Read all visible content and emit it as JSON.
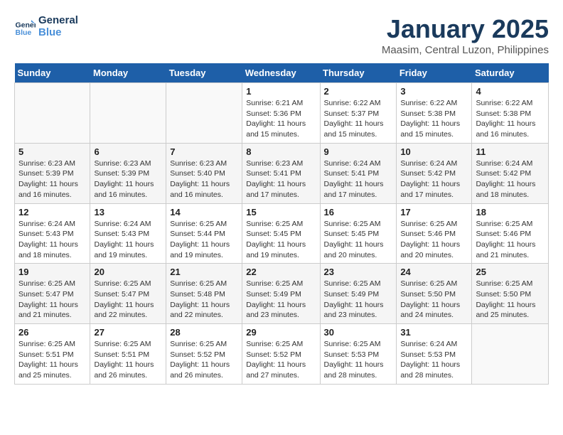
{
  "header": {
    "logo_line1": "General",
    "logo_line2": "Blue",
    "month": "January 2025",
    "location": "Maasim, Central Luzon, Philippines"
  },
  "weekdays": [
    "Sunday",
    "Monday",
    "Tuesday",
    "Wednesday",
    "Thursday",
    "Friday",
    "Saturday"
  ],
  "weeks": [
    [
      {
        "day": "",
        "info": ""
      },
      {
        "day": "",
        "info": ""
      },
      {
        "day": "",
        "info": ""
      },
      {
        "day": "1",
        "info": "Sunrise: 6:21 AM\nSunset: 5:36 PM\nDaylight: 11 hours\nand 15 minutes."
      },
      {
        "day": "2",
        "info": "Sunrise: 6:22 AM\nSunset: 5:37 PM\nDaylight: 11 hours\nand 15 minutes."
      },
      {
        "day": "3",
        "info": "Sunrise: 6:22 AM\nSunset: 5:38 PM\nDaylight: 11 hours\nand 15 minutes."
      },
      {
        "day": "4",
        "info": "Sunrise: 6:22 AM\nSunset: 5:38 PM\nDaylight: 11 hours\nand 16 minutes."
      }
    ],
    [
      {
        "day": "5",
        "info": "Sunrise: 6:23 AM\nSunset: 5:39 PM\nDaylight: 11 hours\nand 16 minutes."
      },
      {
        "day": "6",
        "info": "Sunrise: 6:23 AM\nSunset: 5:39 PM\nDaylight: 11 hours\nand 16 minutes."
      },
      {
        "day": "7",
        "info": "Sunrise: 6:23 AM\nSunset: 5:40 PM\nDaylight: 11 hours\nand 16 minutes."
      },
      {
        "day": "8",
        "info": "Sunrise: 6:23 AM\nSunset: 5:41 PM\nDaylight: 11 hours\nand 17 minutes."
      },
      {
        "day": "9",
        "info": "Sunrise: 6:24 AM\nSunset: 5:41 PM\nDaylight: 11 hours\nand 17 minutes."
      },
      {
        "day": "10",
        "info": "Sunrise: 6:24 AM\nSunset: 5:42 PM\nDaylight: 11 hours\nand 17 minutes."
      },
      {
        "day": "11",
        "info": "Sunrise: 6:24 AM\nSunset: 5:42 PM\nDaylight: 11 hours\nand 18 minutes."
      }
    ],
    [
      {
        "day": "12",
        "info": "Sunrise: 6:24 AM\nSunset: 5:43 PM\nDaylight: 11 hours\nand 18 minutes."
      },
      {
        "day": "13",
        "info": "Sunrise: 6:24 AM\nSunset: 5:43 PM\nDaylight: 11 hours\nand 19 minutes."
      },
      {
        "day": "14",
        "info": "Sunrise: 6:25 AM\nSunset: 5:44 PM\nDaylight: 11 hours\nand 19 minutes."
      },
      {
        "day": "15",
        "info": "Sunrise: 6:25 AM\nSunset: 5:45 PM\nDaylight: 11 hours\nand 19 minutes."
      },
      {
        "day": "16",
        "info": "Sunrise: 6:25 AM\nSunset: 5:45 PM\nDaylight: 11 hours\nand 20 minutes."
      },
      {
        "day": "17",
        "info": "Sunrise: 6:25 AM\nSunset: 5:46 PM\nDaylight: 11 hours\nand 20 minutes."
      },
      {
        "day": "18",
        "info": "Sunrise: 6:25 AM\nSunset: 5:46 PM\nDaylight: 11 hours\nand 21 minutes."
      }
    ],
    [
      {
        "day": "19",
        "info": "Sunrise: 6:25 AM\nSunset: 5:47 PM\nDaylight: 11 hours\nand 21 minutes."
      },
      {
        "day": "20",
        "info": "Sunrise: 6:25 AM\nSunset: 5:47 PM\nDaylight: 11 hours\nand 22 minutes."
      },
      {
        "day": "21",
        "info": "Sunrise: 6:25 AM\nSunset: 5:48 PM\nDaylight: 11 hours\nand 22 minutes."
      },
      {
        "day": "22",
        "info": "Sunrise: 6:25 AM\nSunset: 5:49 PM\nDaylight: 11 hours\nand 23 minutes."
      },
      {
        "day": "23",
        "info": "Sunrise: 6:25 AM\nSunset: 5:49 PM\nDaylight: 11 hours\nand 23 minutes."
      },
      {
        "day": "24",
        "info": "Sunrise: 6:25 AM\nSunset: 5:50 PM\nDaylight: 11 hours\nand 24 minutes."
      },
      {
        "day": "25",
        "info": "Sunrise: 6:25 AM\nSunset: 5:50 PM\nDaylight: 11 hours\nand 25 minutes."
      }
    ],
    [
      {
        "day": "26",
        "info": "Sunrise: 6:25 AM\nSunset: 5:51 PM\nDaylight: 11 hours\nand 25 minutes."
      },
      {
        "day": "27",
        "info": "Sunrise: 6:25 AM\nSunset: 5:51 PM\nDaylight: 11 hours\nand 26 minutes."
      },
      {
        "day": "28",
        "info": "Sunrise: 6:25 AM\nSunset: 5:52 PM\nDaylight: 11 hours\nand 26 minutes."
      },
      {
        "day": "29",
        "info": "Sunrise: 6:25 AM\nSunset: 5:52 PM\nDaylight: 11 hours\nand 27 minutes."
      },
      {
        "day": "30",
        "info": "Sunrise: 6:25 AM\nSunset: 5:53 PM\nDaylight: 11 hours\nand 28 minutes."
      },
      {
        "day": "31",
        "info": "Sunrise: 6:24 AM\nSunset: 5:53 PM\nDaylight: 11 hours\nand 28 minutes."
      },
      {
        "day": "",
        "info": ""
      }
    ]
  ]
}
